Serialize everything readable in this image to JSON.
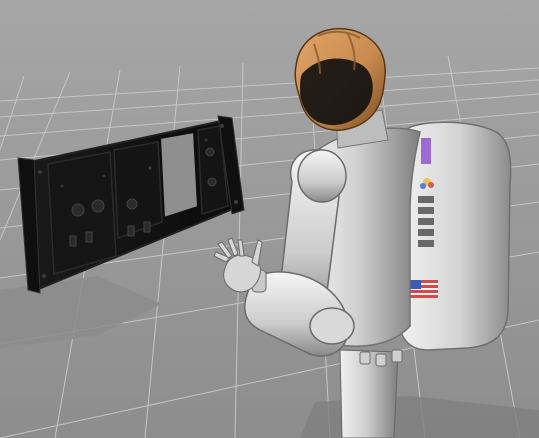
{
  "viewport": {
    "background_color": "#9b9b9b",
    "grid_color": "#c8c8c8",
    "shadow_color": "#8c8c8c"
  },
  "scene": {
    "panel": {
      "name": "task-board-panel",
      "frame_color": "#111111",
      "window_color": "#8f8f8f"
    },
    "robot": {
      "name": "humanoid-robot",
      "helmet_color": "#c98b4f",
      "body_color": "#cfcfcf",
      "backpack_stripe_color": "#9b6bd1",
      "flag_label": "US flag patch"
    }
  }
}
